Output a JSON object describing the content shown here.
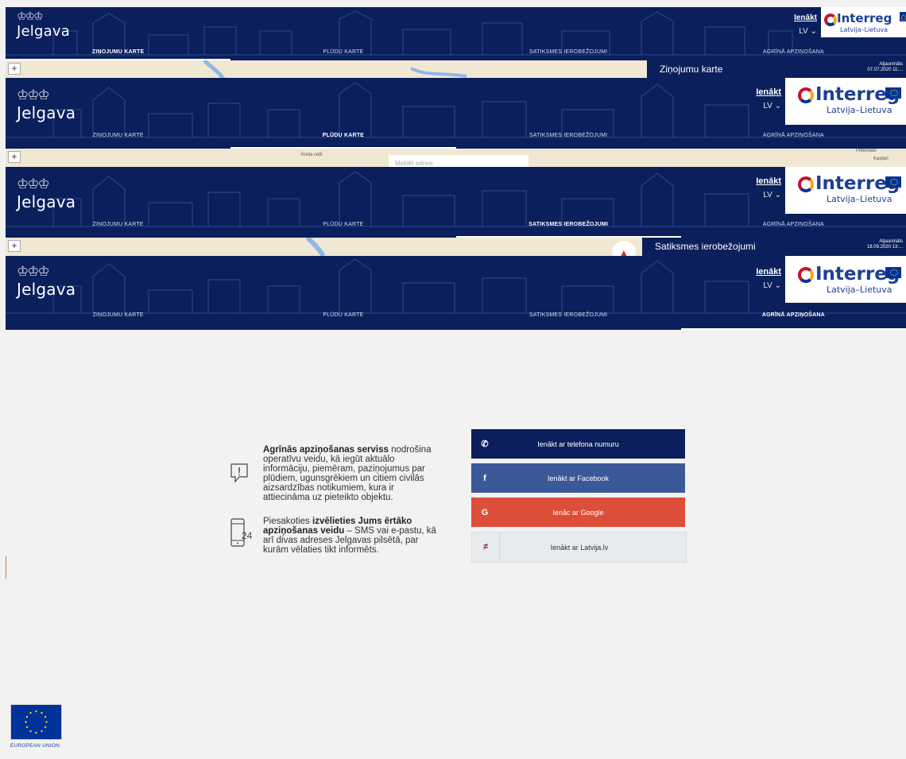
{
  "brand": {
    "name": "Jelgava"
  },
  "header": {
    "login_label": "Ienākt",
    "language": "LV ⌄",
    "partner": {
      "title": "Interreg",
      "subtitle": "Latvija–Lietuva"
    }
  },
  "nav": {
    "tabs": [
      {
        "label": "Ziņojumu karte"
      },
      {
        "label": "Plūdu karte"
      },
      {
        "label": "Satiksmes ierobežojumi"
      },
      {
        "label": "Agrīnā apziņošana"
      }
    ]
  },
  "strips": [
    {
      "active_tab": 0,
      "map_panel_title": "Ziņojumu karte",
      "map_panel_update": "Atjaunināts\n07.07.2020 11:..."
    },
    {
      "active_tab": 1,
      "map_address_placeholder": "Meklēt adresi",
      "map_labels": [
        "Kreta ceļš",
        "Piltemieki",
        "Kaștari"
      ]
    },
    {
      "active_tab": 2,
      "map_panel_title": "Satiksmes ierobežojumi",
      "map_panel_update": "Atjaunināts\n18.09.2020 13:..."
    },
    {
      "active_tab": 3
    }
  ],
  "map": {
    "zoom_in": "+"
  },
  "info": {
    "block1_bold": "Agrīnās apziņošanas serviss",
    "block1_rest": " nodrošina operatīvu veidu, kā iegūt aktuālo informāciju, piemēram, paziņojumus par plūdiem, ugunsgrēkiem un citiem civilās aizsardzības notikumiem, kura ir attiecināma uz pieteikto objektu.",
    "block2_start": "Piesakoties ",
    "block2_bold": "izvēlieties Jums ērtāko apziņošanas veidu",
    "block2_rest": " – SMS vai e-pastu, kā arī divas adreses Jelgavas pilsētā, par kurām vēlaties tikt informēts.",
    "icon2_text": "24"
  },
  "login_buttons": {
    "phone": "Ienākt ar telefona numuru",
    "facebook": "Ienākt ar Facebook",
    "google": "Ienāc ar Google",
    "latvija": "Ienākt ar Latvija.lv"
  },
  "footer": {
    "eu_label": "EUROPEAN UNION"
  },
  "colors": {
    "header": "#0b1f5c",
    "facebook": "#3b5999",
    "google": "#dc4e38"
  }
}
